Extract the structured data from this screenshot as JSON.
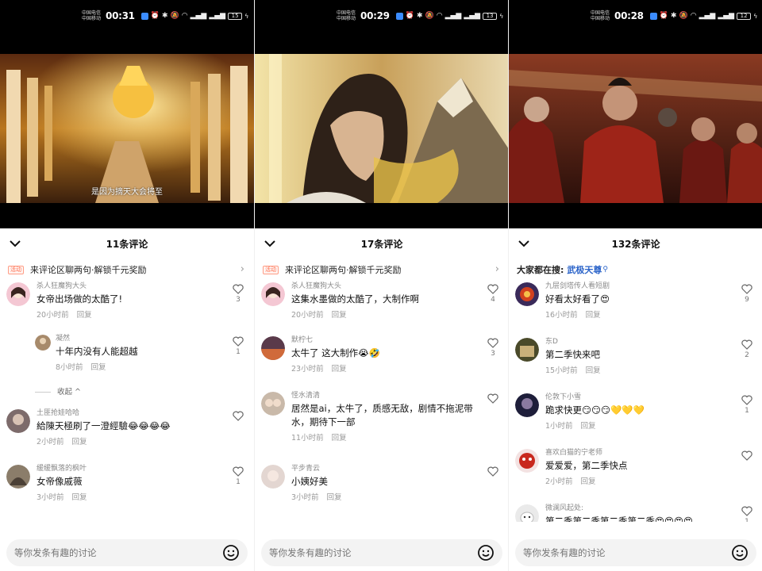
{
  "panels": [
    {
      "status": {
        "carrier1": "中国电信",
        "carrier2": "中国移动",
        "time": "00:31",
        "battery": "15"
      },
      "subtitle": "是因为摘天大会将至",
      "comment_count": "11条评论",
      "promo": {
        "tag": "活动",
        "text": "来评论区聊两句·解锁千元奖励"
      },
      "comments": [
        {
          "user": "杀人狂魔狗大头",
          "text": "女帝出场做的太酷了!",
          "time": "20小时前",
          "reply": "回复",
          "likes": "3"
        },
        {
          "user": "凝然",
          "text": "十年内没有人能超越",
          "time": "8小时前",
          "reply": "回复",
          "likes": "1",
          "is_reply": true
        },
        {
          "user": "土匪抢娃哈哈",
          "text": "給陳天極刷了一澄經驗😂😂😂😂",
          "time": "2小时前",
          "reply": "回复",
          "likes": ""
        },
        {
          "user": "缓缓飘落的枫叶",
          "text": "女帝像戚薇",
          "time": "3小时前",
          "reply": "回复",
          "likes": "1"
        }
      ],
      "collapse_label": "收起",
      "input_placeholder": "等你发条有趣的讨论"
    },
    {
      "status": {
        "carrier1": "中国电信",
        "carrier2": "中国移动",
        "time": "00:29",
        "battery": "13"
      },
      "subtitle": "",
      "comment_count": "17条评论",
      "promo": {
        "tag": "活动",
        "text": "来评论区聊两句·解锁千元奖励"
      },
      "comments": [
        {
          "user": "杀人狂魔狗大头",
          "text": "这集水墨做的太酷了，大制作啊",
          "time": "20小时前",
          "reply": "回复",
          "likes": "4"
        },
        {
          "user": "默柠七",
          "text": "太牛了 这大制作😭🤣",
          "time": "23小时前",
          "reply": "回复",
          "likes": "3"
        },
        {
          "user": "怪水清清",
          "text": "居然是ai，太牛了，质感无敌，剧情不拖泥带水，期待下一部",
          "time": "11小时前",
          "reply": "回复",
          "likes": ""
        },
        {
          "user": "平步青云",
          "text": "小姨好美",
          "time": "3小时前",
          "reply": "回复",
          "likes": ""
        }
      ],
      "input_placeholder": "等你发条有趣的讨论"
    },
    {
      "status": {
        "carrier1": "中国电信",
        "carrier2": "中国移动",
        "time": "00:28",
        "battery": "12"
      },
      "subtitle": "",
      "comment_count": "132条评论",
      "search": {
        "label": "大家都在搜:",
        "term": "武极天尊"
      },
      "comments": [
        {
          "user": "九层剑塔传人看短剧",
          "text": "好看太好看了😍",
          "time": "16小时前",
          "reply": "回复",
          "likes": "9"
        },
        {
          "user": "东D",
          "text": "第二季快来吧",
          "time": "15小时前",
          "reply": "回复",
          "likes": "2"
        },
        {
          "user": "伦敦下小雪",
          "text": "跪求快更😏😏😏💛💛💛",
          "time": "1小时前",
          "reply": "回复",
          "likes": "1"
        },
        {
          "user": "喜欢白猫的宁老师",
          "text": "爱爱爱，第二季快点",
          "time": "2小时前",
          "reply": "回复",
          "likes": ""
        },
        {
          "user": "微澜风起处:",
          "text": "第二季第二季第二季第二季😍😍😍😍",
          "time": "",
          "reply": "",
          "likes": "1"
        }
      ],
      "input_placeholder": "等你发条有趣的讨论"
    }
  ]
}
